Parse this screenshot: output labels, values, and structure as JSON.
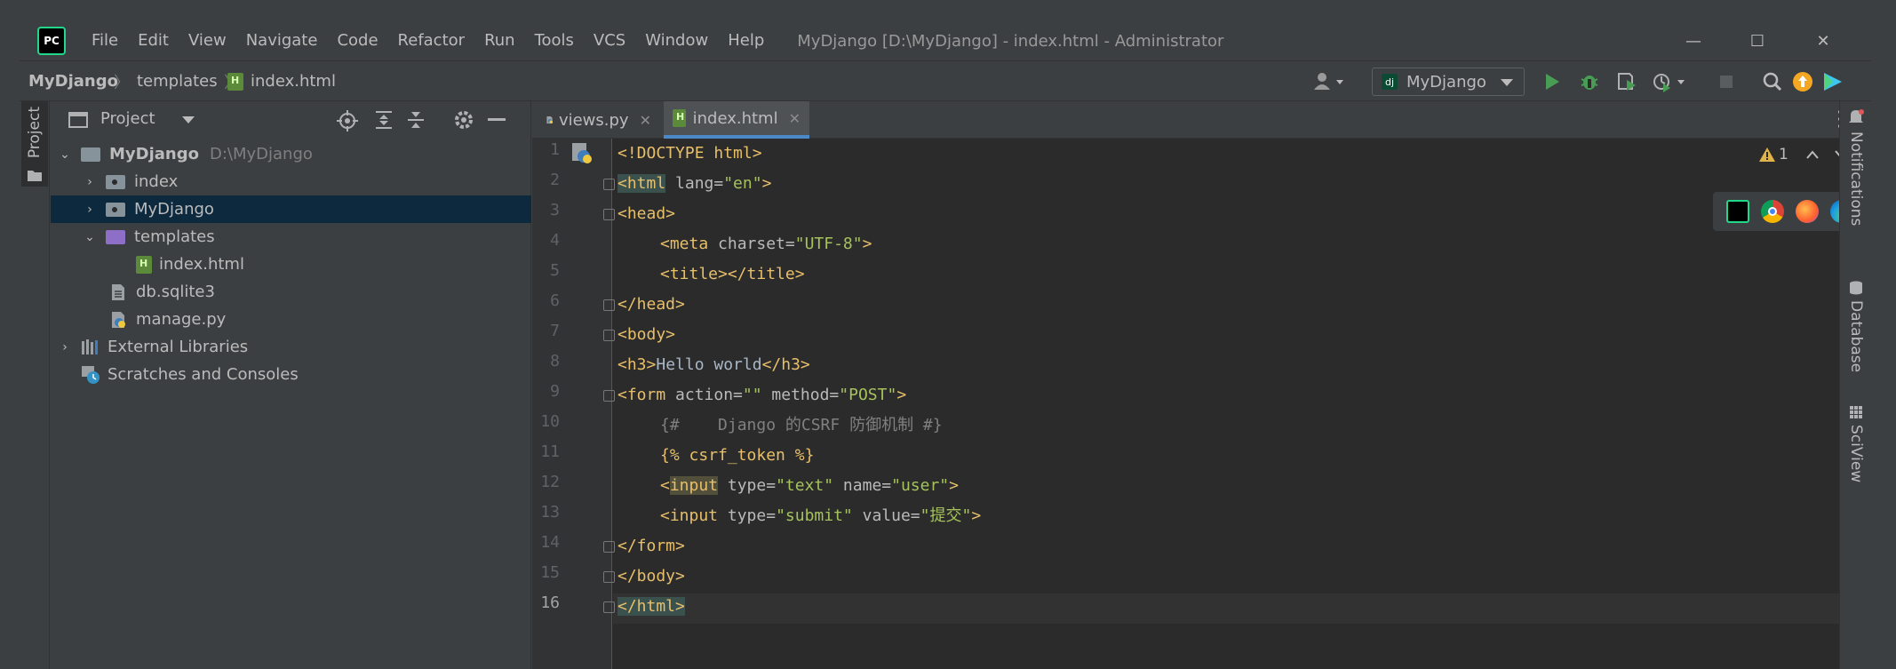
{
  "titlebar": {
    "menu": [
      {
        "label": "File",
        "mn": "F",
        "rest": "ile"
      },
      {
        "label": "Edit",
        "mn": "E",
        "rest": "dit"
      },
      {
        "label": "View",
        "mn": "V",
        "rest": "iew"
      },
      {
        "label": "Navigate",
        "mn": "N",
        "rest": "avigate"
      },
      {
        "label": "Code",
        "mn": "C",
        "rest": "ode"
      },
      {
        "label": "Refactor",
        "mn": "R",
        "rest": "efactor"
      },
      {
        "label": "Run",
        "mn": "R",
        "rest": "un",
        "pre": "",
        "alt": "u"
      },
      {
        "label": "Tools",
        "mn": "T",
        "rest": "ools"
      },
      {
        "label": "VCS",
        "mn": "",
        "rest": "VCS"
      },
      {
        "label": "Window",
        "mn": "W",
        "rest": "indow"
      },
      {
        "label": "Help",
        "mn": "H",
        "rest": "elp"
      }
    ],
    "title": "MyDjango [D:\\MyDjango] - index.html - Administrator",
    "app_logo": "PC",
    "controls": {
      "minimize": "—",
      "maximize": "☐",
      "close": "✕"
    }
  },
  "breadcrumb": {
    "project": "MyDjango",
    "folder": "templates",
    "file": "index.html"
  },
  "toolbar": {
    "run_config": "MyDjango",
    "run_config_badge": "dj"
  },
  "left_strip": {
    "project_label": "Project"
  },
  "project_panel": {
    "title": "Project",
    "tree": [
      {
        "label": "MyDjango",
        "path": "D:\\MyDjango"
      },
      {
        "label": "index"
      },
      {
        "label": "MyDjango"
      },
      {
        "label": "templates"
      },
      {
        "label": "index.html"
      },
      {
        "label": "db.sqlite3"
      },
      {
        "label": "manage.py"
      },
      {
        "label": "External Libraries"
      },
      {
        "label": "Scratches and Consoles"
      }
    ]
  },
  "editor": {
    "tabs": [
      {
        "label": "views.py"
      },
      {
        "label": "index.html"
      }
    ],
    "line_numbers": [
      "1",
      "2",
      "3",
      "4",
      "5",
      "6",
      "7",
      "8",
      "9",
      "10",
      "11",
      "12",
      "13",
      "14",
      "15",
      "16"
    ],
    "warnings": "1",
    "code": {
      "l1": {
        "a": "<!DOCTYPE html>"
      },
      "l2": {
        "a": "<html",
        "b": " lang=",
        "c": "\"en\"",
        "d": ">"
      },
      "l3": {
        "a": "<head>"
      },
      "l4": {
        "a": "<meta",
        "b": " charset=",
        "c": "\"UTF-8\"",
        "d": ">"
      },
      "l5": {
        "a": "<title></title>"
      },
      "l6": {
        "a": "</head>"
      },
      "l7": {
        "a": "<body>"
      },
      "l8": {
        "a": "<h3>",
        "b": "Hello world",
        "c": "</h3>"
      },
      "l9": {
        "a": "<form",
        "b": " action=",
        "c": "\"\"",
        "d": " method=",
        "e": "\"POST\"",
        "f": ">"
      },
      "l10": {
        "a": "{#    Django 的CSRF 防御机制 #}"
      },
      "l11": {
        "a": "{% ",
        "b": "csrf_token",
        "c": " %}"
      },
      "l12": {
        "a": "<",
        "b": "input",
        "c": " type=",
        "d": "\"text\"",
        "e": " name=",
        "f": "\"user\"",
        "g": ">"
      },
      "l13": {
        "a": "<input",
        "b": " type=",
        "c": "\"submit\"",
        "d": " value=",
        "e": "\"提交\"",
        "f": ">"
      },
      "l14": {
        "a": "</form>"
      },
      "l15": {
        "a": "</body>"
      },
      "l16": {
        "a": "</html>"
      }
    }
  },
  "right_strip": {
    "notifications": "Notifications",
    "database": "Database",
    "sciview": "SciView"
  },
  "colors": {
    "tag": "#e8bf6a",
    "string": "#a5c25c",
    "comment": "#808080",
    "accent": "#4a88c7",
    "selection": "#0d293e"
  }
}
